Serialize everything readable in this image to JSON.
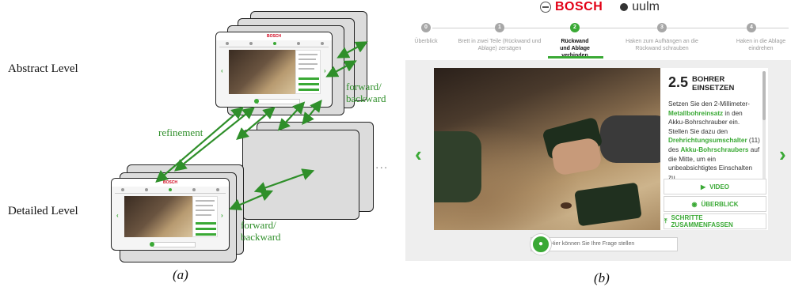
{
  "diagram": {
    "abstract_level": "Abstract Level",
    "detailed_level": "Detailed Level",
    "refinement": "refinement",
    "forward_backward_top": [
      "forward/",
      "backward"
    ],
    "forward_backward_bottom": [
      "forward/",
      "backward"
    ],
    "ellipsis": "...",
    "caption_a": "(a)",
    "caption_b": "(b)",
    "mini_brand": "BOSCH"
  },
  "ui": {
    "brand_bosch": "BOSCH",
    "brand_uulm": "uulm",
    "steps": [
      {
        "num": "0",
        "label": "Überblick",
        "active": false
      },
      {
        "num": "1",
        "label": "Brett in zwei Teile (Rückwand und Ablage) zersägen",
        "active": false
      },
      {
        "num": "2",
        "label": "Rückwand und Ablage verbinden",
        "active": true
      },
      {
        "num": "3",
        "label": "Haken zum Aufhängen an die Rückwand schrauben",
        "active": false
      },
      {
        "num": "4",
        "label": "Haken in die Ablage eindrehen",
        "active": false
      }
    ],
    "panel": {
      "number": "2.5",
      "title_line1": "BOHRER",
      "title_line2": "EINSETZEN",
      "body": [
        {
          "t": "Setzen Sie den 2-Millimeter-",
          "g": false
        },
        {
          "t": "Metallbohreinsatz",
          "g": true
        },
        {
          "t": " in den Akku-Bohrschrauber ein. Stellen Sie dazu den ",
          "g": false
        },
        {
          "t": "Drehrichtungsumschalter",
          "g": true
        },
        {
          "t": " (11) des ",
          "g": false
        },
        {
          "t": "Akku-Bohrschraubers",
          "g": true
        },
        {
          "t": " auf die Mitte, um ein unbeabsichtigtes Einschalten zu",
          "g": false
        }
      ],
      "buttons": {
        "video": "VIDEO",
        "overview": "ÜBERBLICK",
        "summarize": "SCHRITTE ZUSAMMENFASSEN"
      }
    },
    "question_placeholder": "Hier können Sie Ihre Frage stellen",
    "colors": {
      "accent": "#3aa935",
      "brand": "#e20015"
    }
  }
}
